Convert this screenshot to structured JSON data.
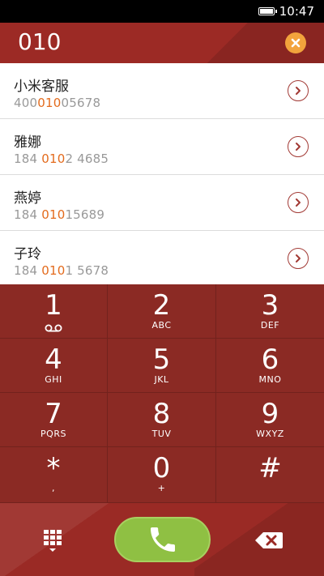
{
  "status_bar": {
    "time": "10:47"
  },
  "dialer": {
    "number": "010"
  },
  "results": [
    {
      "name": "小米客服",
      "num_pre": "400",
      "num_match": "010",
      "num_post": "05678"
    },
    {
      "name": "雅娜",
      "num_pre": "184 ",
      "num_match": "010",
      "num_post": "2 4685"
    },
    {
      "name": "燕婷",
      "num_pre": "184 ",
      "num_match": "010",
      "num_post": "15689"
    },
    {
      "name": "子玲",
      "num_pre": "184 ",
      "num_match": "010",
      "num_post": "1 5678"
    }
  ],
  "keys": [
    {
      "digit": "1",
      "letters": ""
    },
    {
      "digit": "2",
      "letters": "ABC"
    },
    {
      "digit": "3",
      "letters": "DEF"
    },
    {
      "digit": "4",
      "letters": "GHI"
    },
    {
      "digit": "5",
      "letters": "JKL"
    },
    {
      "digit": "6",
      "letters": "MNO"
    },
    {
      "digit": "7",
      "letters": "PQRS"
    },
    {
      "digit": "8",
      "letters": "TUV"
    },
    {
      "digit": "9",
      "letters": "WXYZ"
    },
    {
      "digit": "*",
      "letters": ","
    },
    {
      "digit": "0",
      "letters": "+"
    },
    {
      "digit": "#",
      "letters": ""
    }
  ],
  "icons": {
    "clear": "clear-icon",
    "detail": "chevron-right-icon",
    "voicemail": "voicemail-icon",
    "dialpad": "dialpad-icon",
    "call": "phone-icon",
    "backspace": "backspace-icon"
  },
  "colors": {
    "header_bg": "#9c2a25",
    "keypad_bg": "#8b2a24",
    "match_highlight": "#e36b1d",
    "clear_button": "#f2a33c",
    "call_button": "#8fc043"
  }
}
